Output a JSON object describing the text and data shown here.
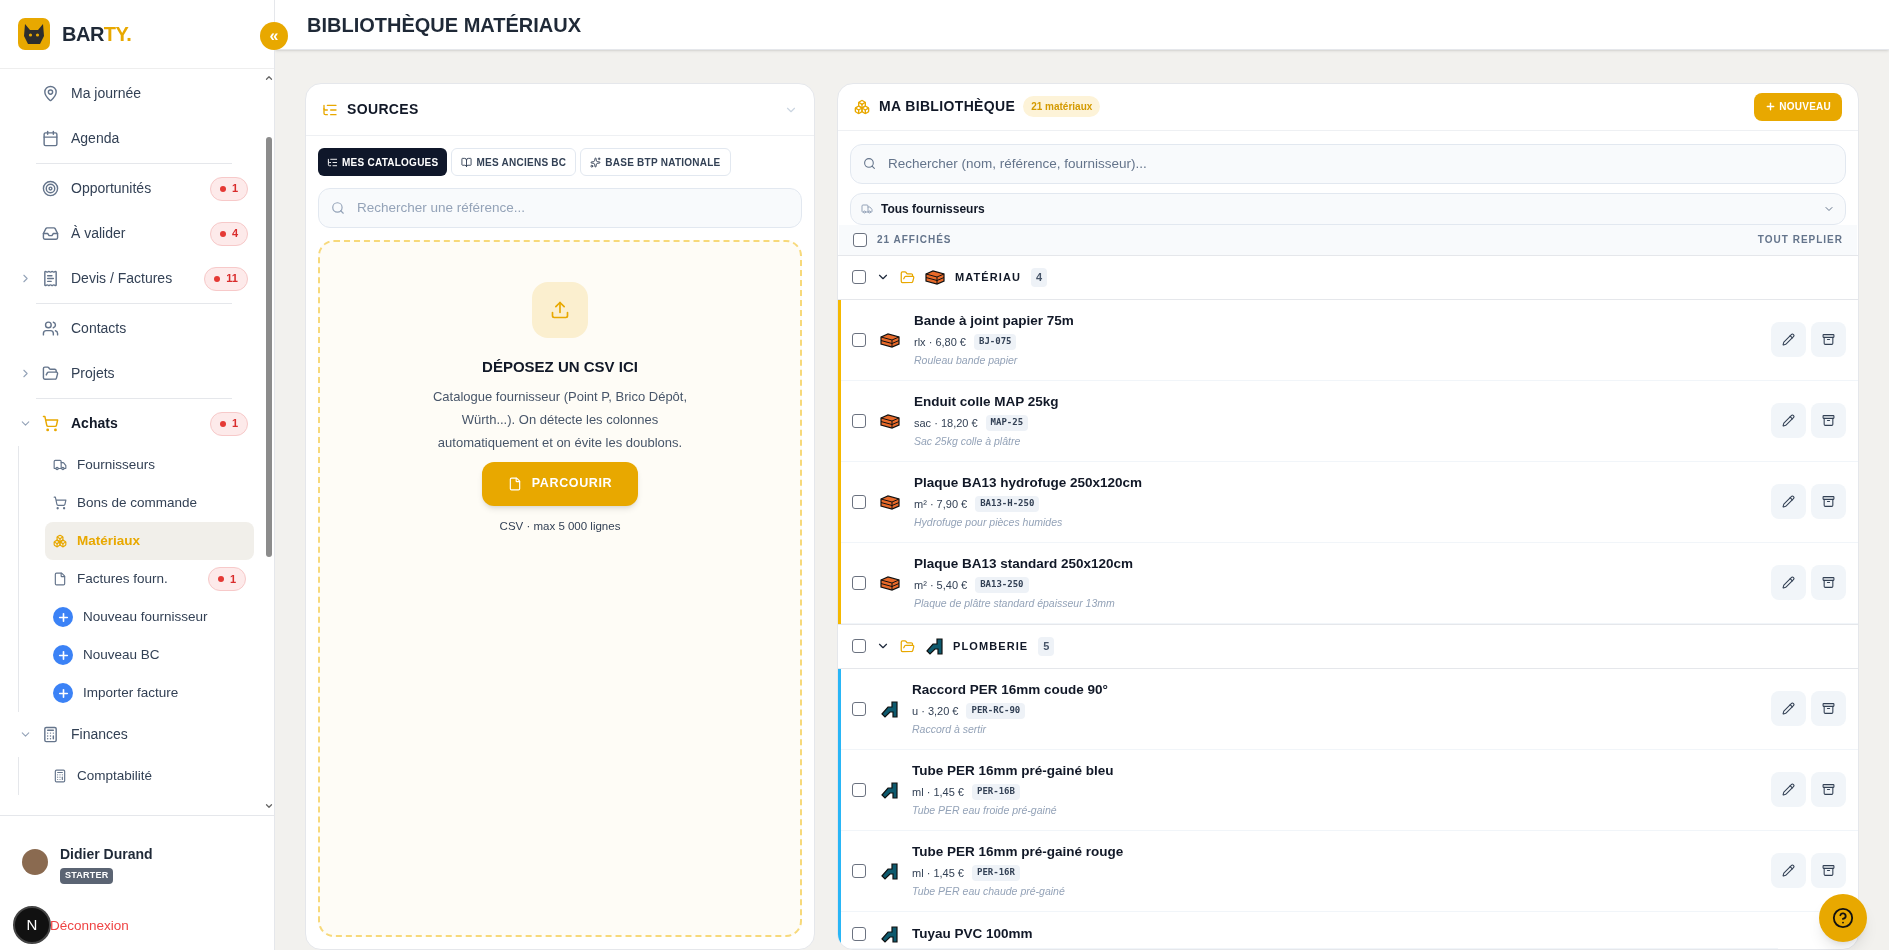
{
  "brand": {
    "name_dark": "BAR",
    "name_accent": "TY."
  },
  "sidebar": {
    "collapse_button": "«",
    "items": [
      {
        "kind": "item",
        "label": "Ma journée",
        "selected": false
      },
      {
        "kind": "item",
        "label": "Agenda",
        "selected": false
      },
      {
        "kind": "divider"
      },
      {
        "kind": "item",
        "label": "Opportunités",
        "badge": "1",
        "selected": false
      },
      {
        "kind": "item",
        "label": "À valider",
        "badge": "4",
        "selected": false
      },
      {
        "kind": "item",
        "label": "Devis / Factures",
        "badge": "11",
        "expanded": false,
        "selected": false
      },
      {
        "kind": "divider"
      },
      {
        "kind": "item",
        "label": "Contacts",
        "selected": false
      },
      {
        "kind": "item",
        "label": "Projets",
        "expanded": false,
        "selected": false
      },
      {
        "kind": "divider"
      },
      {
        "kind": "item",
        "label": "Achats",
        "badge": "1",
        "expanded": true,
        "selected": false,
        "children": [
          {
            "kind": "item",
            "label": "Fournisseurs",
            "selected": false
          },
          {
            "kind": "item",
            "label": "Bons de commande",
            "selected": false
          },
          {
            "kind": "item",
            "label": "Matériaux",
            "selected": true
          },
          {
            "kind": "item",
            "label": "Factures fourn.",
            "badge": "1",
            "selected": false
          },
          {
            "kind": "action",
            "label": "Nouveau fournisseur",
            "selected": false
          },
          {
            "kind": "action",
            "label": "Nouveau BC",
            "selected": false
          },
          {
            "kind": "action",
            "label": "Importer facture",
            "selected": false
          }
        ]
      },
      {
        "kind": "item",
        "label": "Finances",
        "expanded": true,
        "selected": false,
        "children": [
          {
            "kind": "item",
            "label": "Comptabilité",
            "selected": false
          }
        ]
      }
    ]
  },
  "user": {
    "name": "Didier Durand",
    "plan": "STARTER",
    "logout": "Déconnexion",
    "dev_indicator": "N"
  },
  "header": {
    "title": "BIBLIOTHÈQUE MATÉRIAUX"
  },
  "sources": {
    "title": "SOURCES",
    "tabs": [
      {
        "label": "MES CATALOGUES",
        "selected": true
      },
      {
        "label": "MES ANCIENS BC",
        "selected": false
      },
      {
        "label": "BASE BTP NATIONALE",
        "selected": false
      }
    ],
    "search": {
      "placeholder": "Rechercher une référence..."
    },
    "dropzone": {
      "title": "DÉPOSEZ UN CSV ICI",
      "description": "Catalogue fournisseur (Point P, Brico Dépôt, Würth...). On détecte les colonnes automatiquement et on évite les doublons.",
      "button": "PARCOURIR",
      "note": "CSV · max 5 000 lignes"
    }
  },
  "library": {
    "title": "MA BIBLIOTHÈQUE",
    "count": "21 matériaux",
    "new_button": "NOUVEAU",
    "search": {
      "placeholder": "Rechercher (nom, référence, fournisseur)..."
    },
    "supplier_filter": "Tous fournisseurs",
    "shown": "21 AFFICHÉS",
    "select_all_checked": false,
    "collapse_all": "TOUT REPLIER",
    "groups": [
      {
        "kind": "material",
        "name": "MATÉRIAU",
        "count": "4",
        "color": "#f5b800",
        "expanded": true,
        "checked": false,
        "items": [
          {
            "name": "Bande à joint papier 75m",
            "price": "rlx · 6,80 €",
            "ref": "BJ-075",
            "note": "Rouleau bande papier",
            "checked": false
          },
          {
            "name": "Enduit colle MAP 25kg",
            "price": "sac · 18,20 €",
            "ref": "MAP-25",
            "note": "Sac 25kg colle à plâtre",
            "checked": false
          },
          {
            "name": "Plaque BA13 hydrofuge 250x120cm",
            "price": "m² · 7,90 €",
            "ref": "BA13-H-250",
            "note": "Hydrofuge pour pièces humides",
            "checked": false
          },
          {
            "name": "Plaque BA13 standard 250x120cm",
            "price": "m² · 5,40 €",
            "ref": "BA13-250",
            "note": "Plaque de plâtre standard épaisseur 13mm",
            "checked": false
          }
        ]
      },
      {
        "kind": "plumbing",
        "name": "PLOMBERIE",
        "count": "5",
        "color": "#29b6f6",
        "expanded": true,
        "checked": false,
        "items": [
          {
            "name": "Raccord PER 16mm coude 90°",
            "price": "u · 3,20 €",
            "ref": "PER-RC-90",
            "note": "Raccord à sertir",
            "checked": false
          },
          {
            "name": "Tube PER 16mm pré-gainé bleu",
            "price": "ml · 1,45 €",
            "ref": "PER-16B",
            "note": "Tube PER eau froide pré-gainé",
            "checked": false
          },
          {
            "name": "Tube PER 16mm pré-gainé rouge",
            "price": "ml · 1,45 €",
            "ref": "PER-16R",
            "note": "Tube PER eau chaude pré-gainé",
            "checked": false
          },
          {
            "name": "Tuyau PVC 100mm",
            "checked": false
          }
        ]
      }
    ]
  }
}
